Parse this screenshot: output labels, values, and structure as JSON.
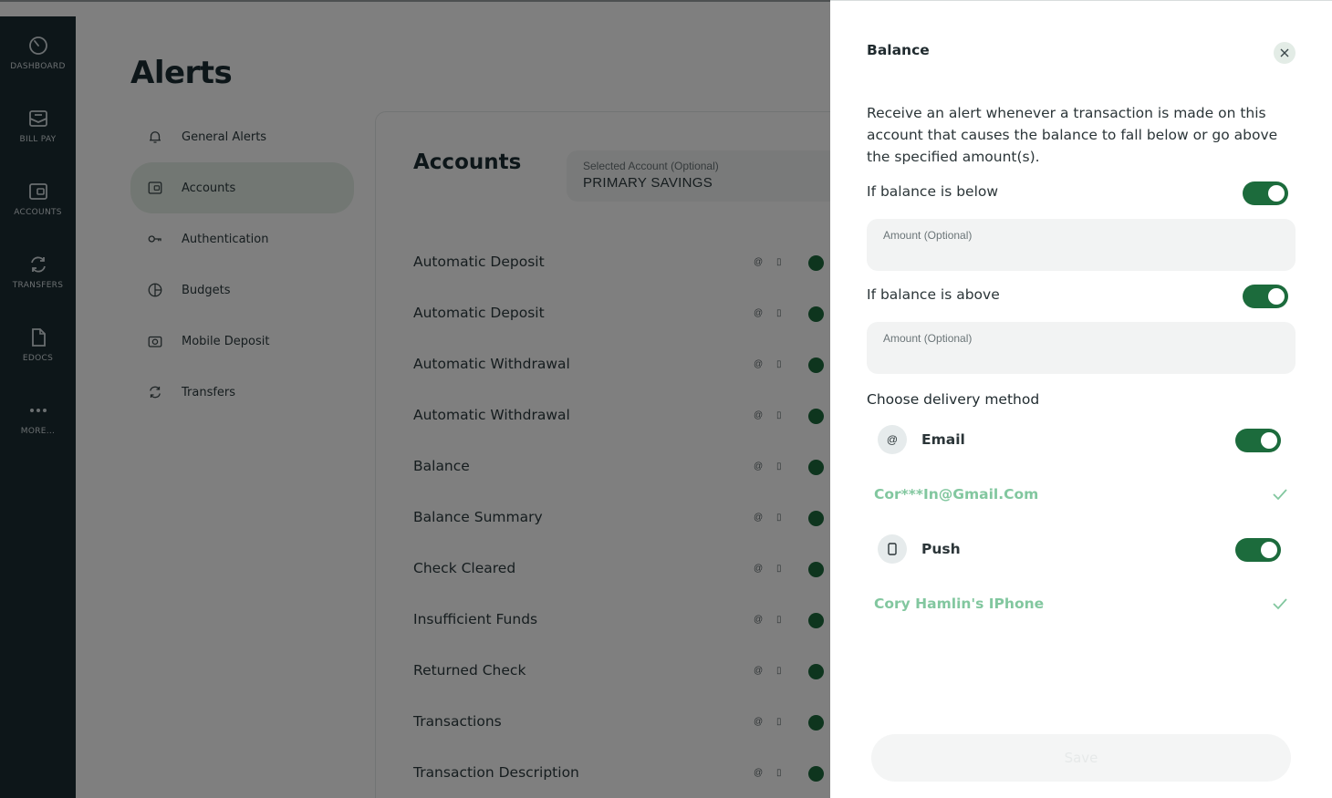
{
  "nav": {
    "items": [
      {
        "label": "DASHBOARD",
        "icon": "dashboard-icon"
      },
      {
        "label": "BILL PAY",
        "icon": "bill-pay-icon"
      },
      {
        "label": "ACCOUNTS",
        "icon": "wallet-icon"
      },
      {
        "label": "TRANSFERS",
        "icon": "transfer-icon"
      },
      {
        "label": "EDOCS",
        "icon": "document-icon"
      },
      {
        "label": "MORE...",
        "icon": "more-icon"
      }
    ]
  },
  "page": {
    "title": "Alerts",
    "categories": [
      {
        "label": "General Alerts",
        "icon": "bell-icon",
        "active": false
      },
      {
        "label": "Accounts",
        "icon": "wallet-icon",
        "active": true
      },
      {
        "label": "Authentication",
        "icon": "key-icon",
        "active": false
      },
      {
        "label": "Budgets",
        "icon": "pie-chart-icon",
        "active": false
      },
      {
        "label": "Mobile Deposit",
        "icon": "camera-icon",
        "active": false
      },
      {
        "label": "Transfers",
        "icon": "transfer-icon",
        "active": false
      }
    ]
  },
  "accounts": {
    "title": "Accounts",
    "select_label": "Selected Account (Optional)",
    "select_value": "PRIMARY SAVINGS",
    "alerts": [
      "Automatic Deposit",
      "Automatic Deposit",
      "Automatic Withdrawal",
      "Automatic Withdrawal",
      "Balance",
      "Balance Summary",
      "Check Cleared",
      "Insufficient Funds",
      "Returned Check",
      "Transactions",
      "Transaction Description"
    ]
  },
  "drawer": {
    "title": "Balance",
    "description": "Receive an alert whenever a transaction is made on this account that causes the balance to fall below or go above the specified amount(s).",
    "below": {
      "label": "If balance is below",
      "enabled": true,
      "placeholder": "Amount (Optional)"
    },
    "above": {
      "label": "If balance is above",
      "enabled": true,
      "placeholder": "Amount (Optional)"
    },
    "delivery_heading": "Choose delivery method",
    "methods": [
      {
        "name": "Email",
        "icon_glyph": "@",
        "enabled": true,
        "destination": "Cor***In@Gmail.Com"
      },
      {
        "name": "Push",
        "enabled": true,
        "destination": "Cory Hamlin's IPhone"
      }
    ],
    "save_label": "Save"
  },
  "colors": {
    "nav_bg": "#1b2c33",
    "toggle_on": "#1c6b3c",
    "destination_text": "#82c79f",
    "active_category": "#e4efe6"
  }
}
